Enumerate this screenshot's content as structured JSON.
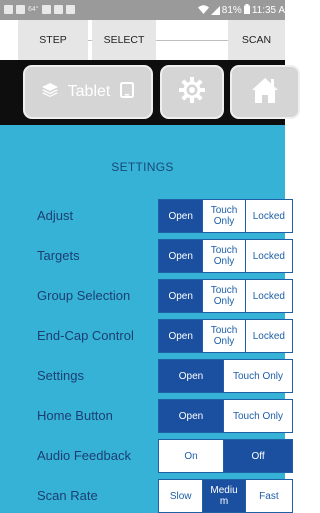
{
  "statusbar": {
    "left_text": "64°",
    "battery": "81%",
    "time": "11:35 A"
  },
  "topmenu": {
    "step": "STEP",
    "select": "SELECT",
    "scan": "SCAN"
  },
  "toolbar": {
    "device_label": "Tablet"
  },
  "settings": {
    "title": "SETTINGS",
    "rows": [
      {
        "label": "Adjust",
        "options": [
          "Open",
          "Touch Only",
          "Locked"
        ],
        "selected": "Open"
      },
      {
        "label": "Targets",
        "options": [
          "Open",
          "Touch Only",
          "Locked"
        ],
        "selected": "Open"
      },
      {
        "label": "Group Selection",
        "options": [
          "Open",
          "Touch Only",
          "Locked"
        ],
        "selected": "Open"
      },
      {
        "label": "End-Cap Control",
        "options": [
          "Open",
          "Touch Only",
          "Locked"
        ],
        "selected": "Open"
      },
      {
        "label": "Settings",
        "options": [
          "Open",
          "Touch Only"
        ],
        "selected": "Open"
      },
      {
        "label": "Home Button",
        "options": [
          "Open",
          "Touch Only"
        ],
        "selected": "Open"
      },
      {
        "label": "Audio Feedback",
        "options": [
          "On",
          "Off"
        ],
        "selected": "Off"
      },
      {
        "label": "Scan Rate",
        "options": [
          "Slow",
          "Medium",
          "Fast"
        ],
        "selected": "Medium"
      }
    ]
  },
  "colors": {
    "panel": "#37b2d7",
    "segment_active": "#1b50a0",
    "label_text": "#1b3f72"
  }
}
